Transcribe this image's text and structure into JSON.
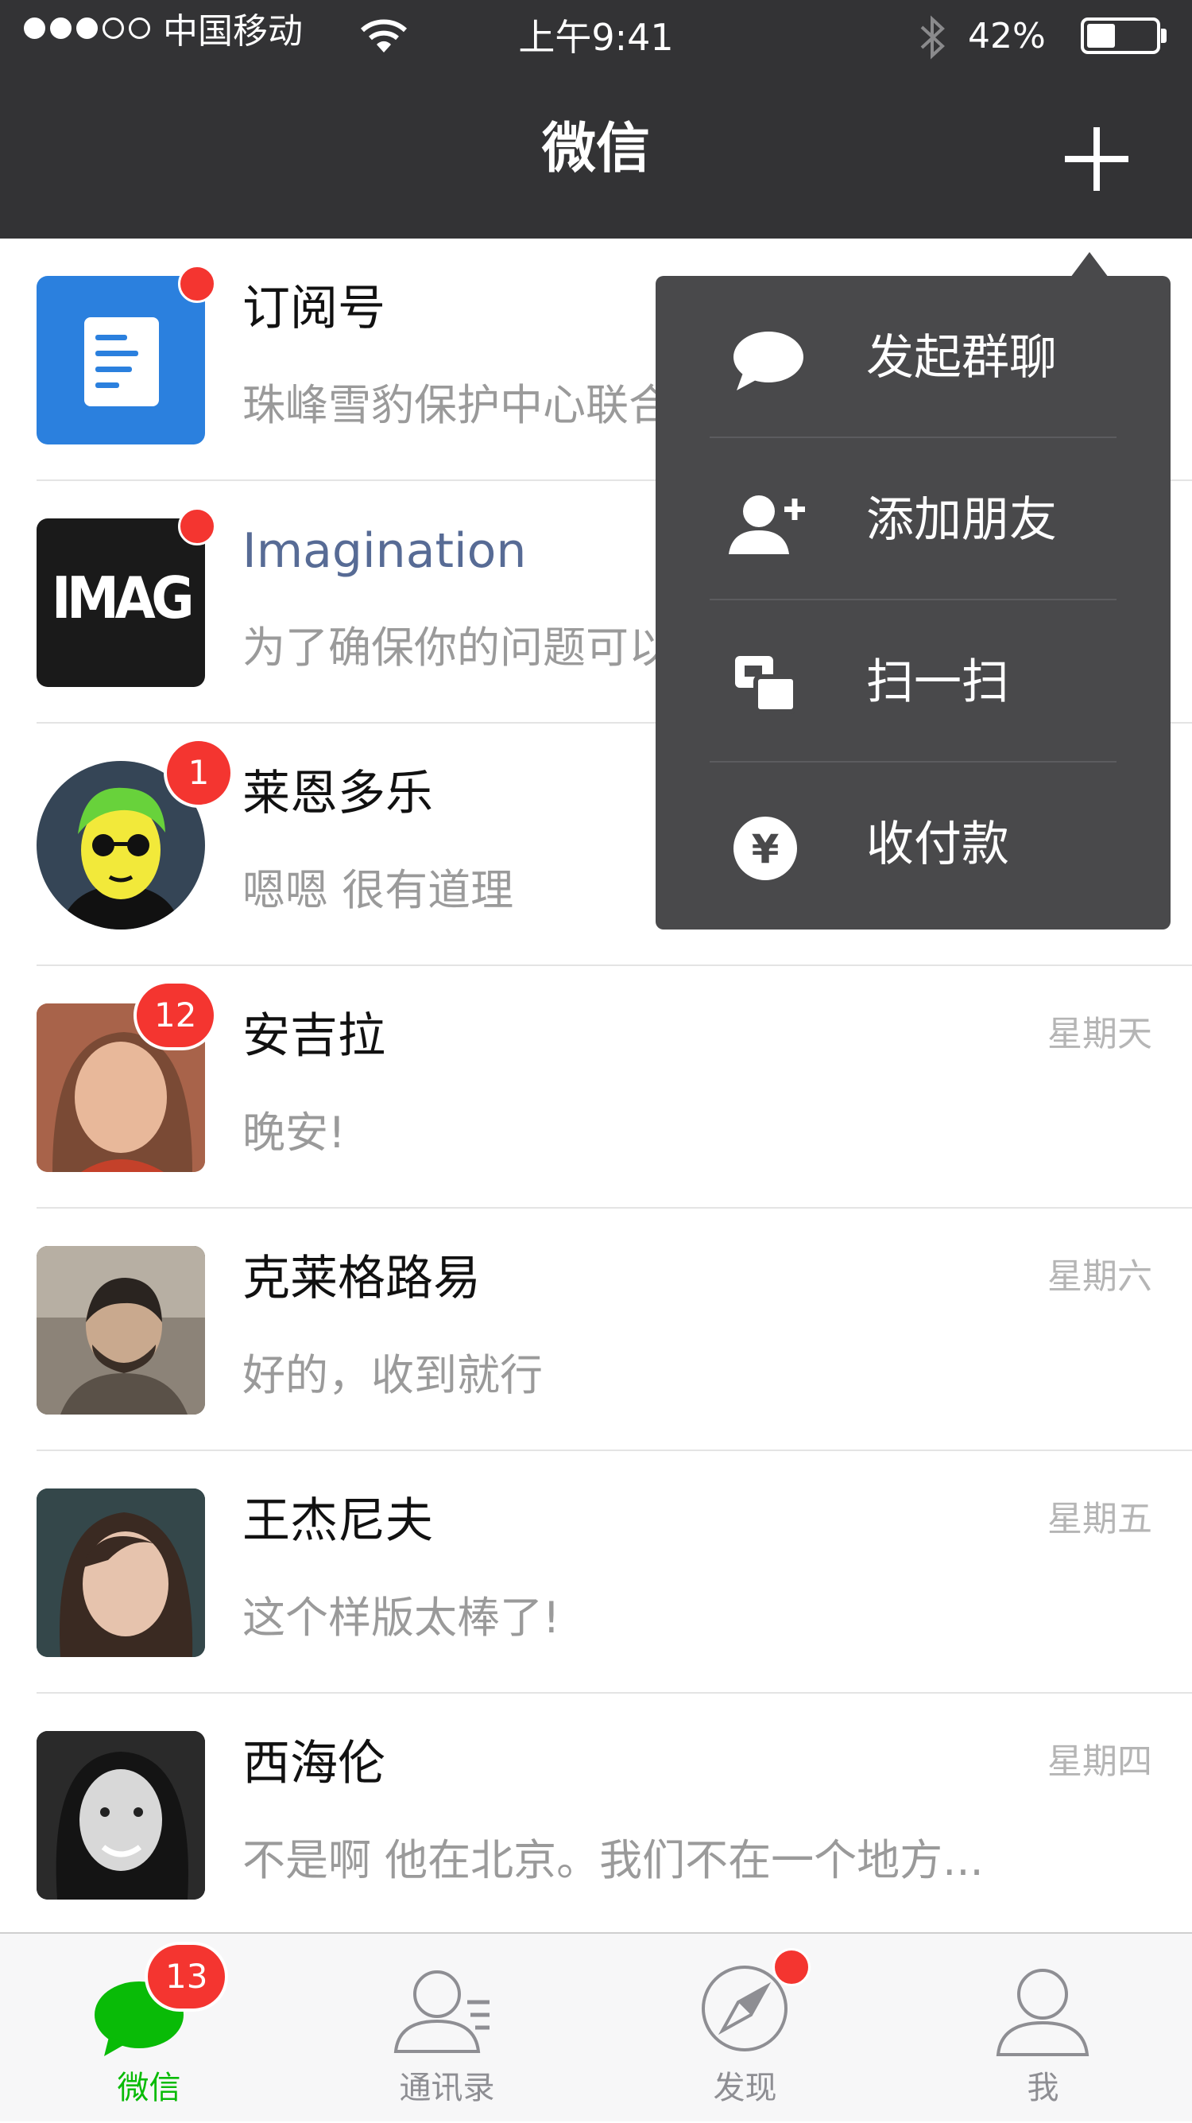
{
  "status_bar": {
    "carrier": "中国移动",
    "time": "上午9:41",
    "battery_percent": "42%",
    "battery_level": 0.42,
    "signal_bars_filled": 3,
    "signal_bars_total": 5
  },
  "nav": {
    "title": "微信",
    "add_icon": "plus-icon"
  },
  "chats": [
    {
      "name": "订阅号",
      "preview": "珠峰雪豹保护中心联合",
      "time": "",
      "badge": "",
      "dot": true,
      "avatar": "subscription-doc-icon"
    },
    {
      "name": "Imagination",
      "preview": "为了确保你的问题可以",
      "time": "",
      "badge": "",
      "dot": true,
      "avatar": "imagination-logo",
      "avatar_text": "IMAG"
    },
    {
      "name": "莱恩多乐",
      "preview": "嗯嗯 很有道理",
      "time": "",
      "badge": "1",
      "dot": false,
      "avatar": "cartoon-avatar"
    },
    {
      "name": "安吉拉",
      "preview": "晚安!",
      "time": "星期天",
      "badge": "12",
      "dot": false,
      "avatar": "photo-avatar"
    },
    {
      "name": "克莱格路易",
      "preview": "好的，收到就行",
      "time": "星期六",
      "badge": "",
      "dot": false,
      "avatar": "photo-avatar"
    },
    {
      "name": "王杰尼夫",
      "preview": "这个样版太棒了!",
      "time": "星期五",
      "badge": "",
      "dot": false,
      "avatar": "photo-avatar"
    },
    {
      "name": "西海伦",
      "preview": "不是啊 他在北京。我们不在一个地方...",
      "time": "星期四",
      "badge": "",
      "dot": false,
      "avatar": "photo-avatar"
    }
  ],
  "popover_menu": [
    {
      "label": "发起群聊",
      "icon": "chat-bubble-icon"
    },
    {
      "label": "添加朋友",
      "icon": "add-friend-icon"
    },
    {
      "label": "扫一扫",
      "icon": "scan-icon"
    },
    {
      "label": "收付款",
      "icon": "yuan-icon"
    }
  ],
  "tabs": [
    {
      "label": "微信",
      "icon": "chats-icon",
      "badge": "13",
      "active": true
    },
    {
      "label": "通讯录",
      "icon": "contacts-icon",
      "badge": "",
      "active": false
    },
    {
      "label": "发现",
      "icon": "compass-icon",
      "badge": "",
      "dot": true,
      "active": false
    },
    {
      "label": "我",
      "icon": "me-icon",
      "badge": "",
      "active": false
    }
  ],
  "colors": {
    "header_bg": "#333335",
    "popover_bg": "#49494b",
    "badge_red": "#f43530",
    "active_green": "#09bb07",
    "name_blue": "#576b95"
  }
}
